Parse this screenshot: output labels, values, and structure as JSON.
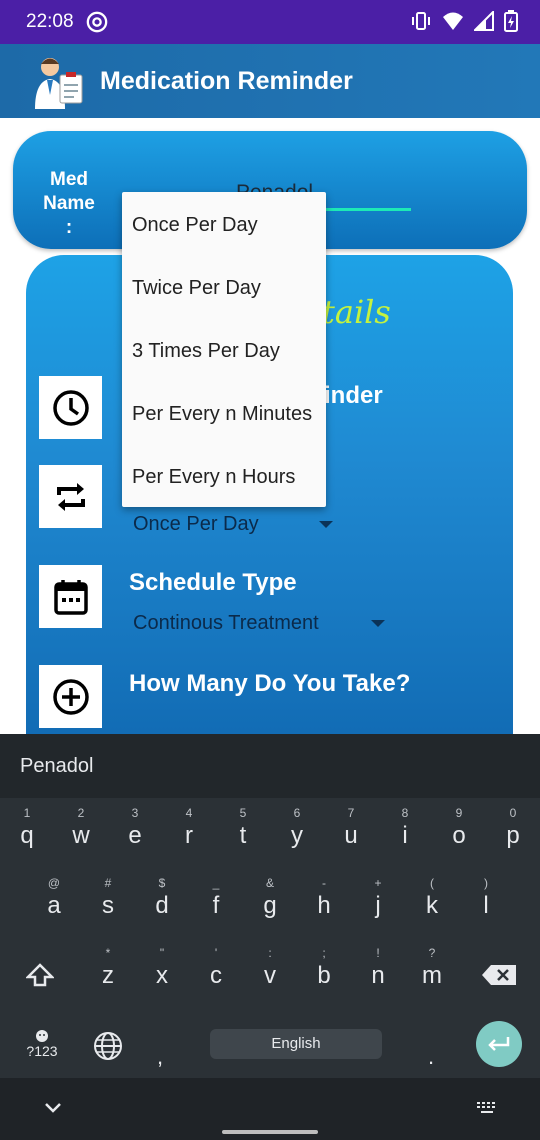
{
  "status_bar": {
    "time": "22:08"
  },
  "app_bar": {
    "title": "Medication Reminder"
  },
  "name_card": {
    "label_line1": "Med",
    "label_line2": "Name :",
    "value": "Penadol"
  },
  "details": {
    "heading_visible": "tails",
    "reminder_title_visible": "inder",
    "frequency_title_visible": "",
    "frequency_value": "Once Per Day",
    "schedule_title": "Schedule Type",
    "schedule_value": "Continous Treatment",
    "quantity_title": "How Many Do You Take?"
  },
  "dropdown": {
    "options": [
      "Once Per Day",
      "Twice Per Day",
      "3 Times Per Day",
      "Per Every n Minutes",
      "Per Every n Hours"
    ]
  },
  "keyboard": {
    "suggestion": "Penadol",
    "row1": [
      {
        "hint": "1",
        "key": "q"
      },
      {
        "hint": "2",
        "key": "w"
      },
      {
        "hint": "3",
        "key": "e"
      },
      {
        "hint": "4",
        "key": "r"
      },
      {
        "hint": "5",
        "key": "t"
      },
      {
        "hint": "6",
        "key": "y"
      },
      {
        "hint": "7",
        "key": "u"
      },
      {
        "hint": "8",
        "key": "i"
      },
      {
        "hint": "9",
        "key": "o"
      },
      {
        "hint": "0",
        "key": "p"
      }
    ],
    "row2": [
      {
        "hint": "@",
        "key": "a"
      },
      {
        "hint": "#",
        "key": "s"
      },
      {
        "hint": "$",
        "key": "d"
      },
      {
        "hint": "_",
        "key": "f"
      },
      {
        "hint": "&",
        "key": "g"
      },
      {
        "hint": "-",
        "key": "h"
      },
      {
        "hint": "+",
        "key": "j"
      },
      {
        "hint": "(",
        "key": "k"
      },
      {
        "hint": ")",
        "key": "l"
      }
    ],
    "row3": [
      {
        "hint": "*",
        "key": "z"
      },
      {
        "hint": "\"",
        "key": "x"
      },
      {
        "hint": "'",
        "key": "c"
      },
      {
        "hint": ":",
        "key": "v"
      },
      {
        "hint": ";",
        "key": "b"
      },
      {
        "hint": "!",
        "key": "n"
      },
      {
        "hint": "?",
        "key": "m"
      }
    ],
    "symbols_label": "?123",
    "comma": ",",
    "period": ".",
    "space_label": "English"
  }
}
